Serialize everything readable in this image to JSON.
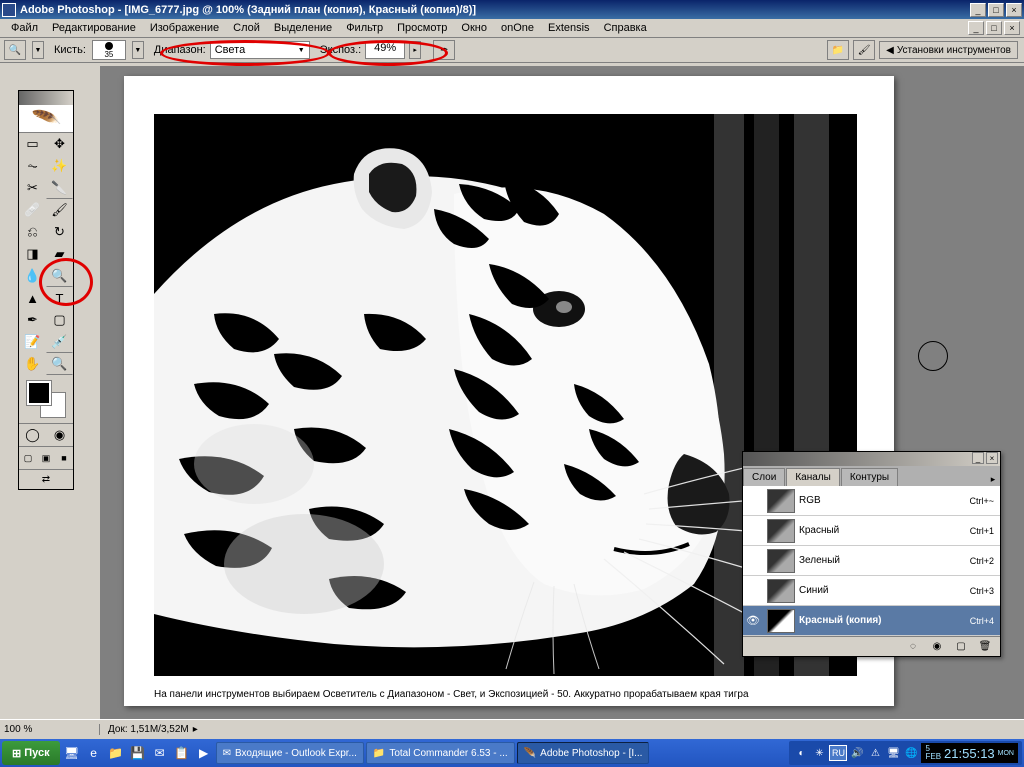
{
  "title": "Adobe Photoshop - [IMG_6777.jpg @ 100% (Задний план (копия), Красный (копия)/8)]",
  "menu": [
    "Файл",
    "Редактирование",
    "Изображение",
    "Слой",
    "Выделение",
    "Фильтр",
    "Просмотр",
    "Окно",
    "onOne",
    "Extensis",
    "Справка"
  ],
  "options": {
    "brush_label": "Кисть:",
    "brush_size": "35",
    "range_label": "Диапазон:",
    "range_value": "Света",
    "expo_label": "Экспоз.:",
    "expo_value": "49%",
    "palette_btn": "Установки инструментов"
  },
  "caption": "На панели инструментов выбираем Осветитель с Диапазоном - Свет, и Экспозицией - 50. Аккуратно прорабатываем края тигра",
  "channels_panel": {
    "tabs": [
      "Слои",
      "Каналы",
      "Контуры"
    ],
    "rows": [
      {
        "name": "RGB",
        "shortcut": "Ctrl+~",
        "visible": false,
        "active": false
      },
      {
        "name": "Красный",
        "shortcut": "Ctrl+1",
        "visible": false,
        "active": false
      },
      {
        "name": "Зеленый",
        "shortcut": "Ctrl+2",
        "visible": false,
        "active": false
      },
      {
        "name": "Синий",
        "shortcut": "Ctrl+3",
        "visible": false,
        "active": false
      },
      {
        "name": "Красный (копия)",
        "shortcut": "Ctrl+4",
        "visible": true,
        "active": true
      }
    ]
  },
  "status": {
    "zoom": "100 %",
    "doc": "Док: 1,51M/3,52M"
  },
  "taskbar": {
    "start": "Пуск",
    "tasks": [
      {
        "label": "Входящие - Outlook Expr...",
        "active": false
      },
      {
        "label": "Total Commander 6.53 - ...",
        "active": false
      },
      {
        "label": "Adobe Photoshop - [I...",
        "active": true
      }
    ],
    "lang": "RU",
    "date_day": "5",
    "date_month": "FEB",
    "time": "21:55:13",
    "dow": "MON"
  }
}
